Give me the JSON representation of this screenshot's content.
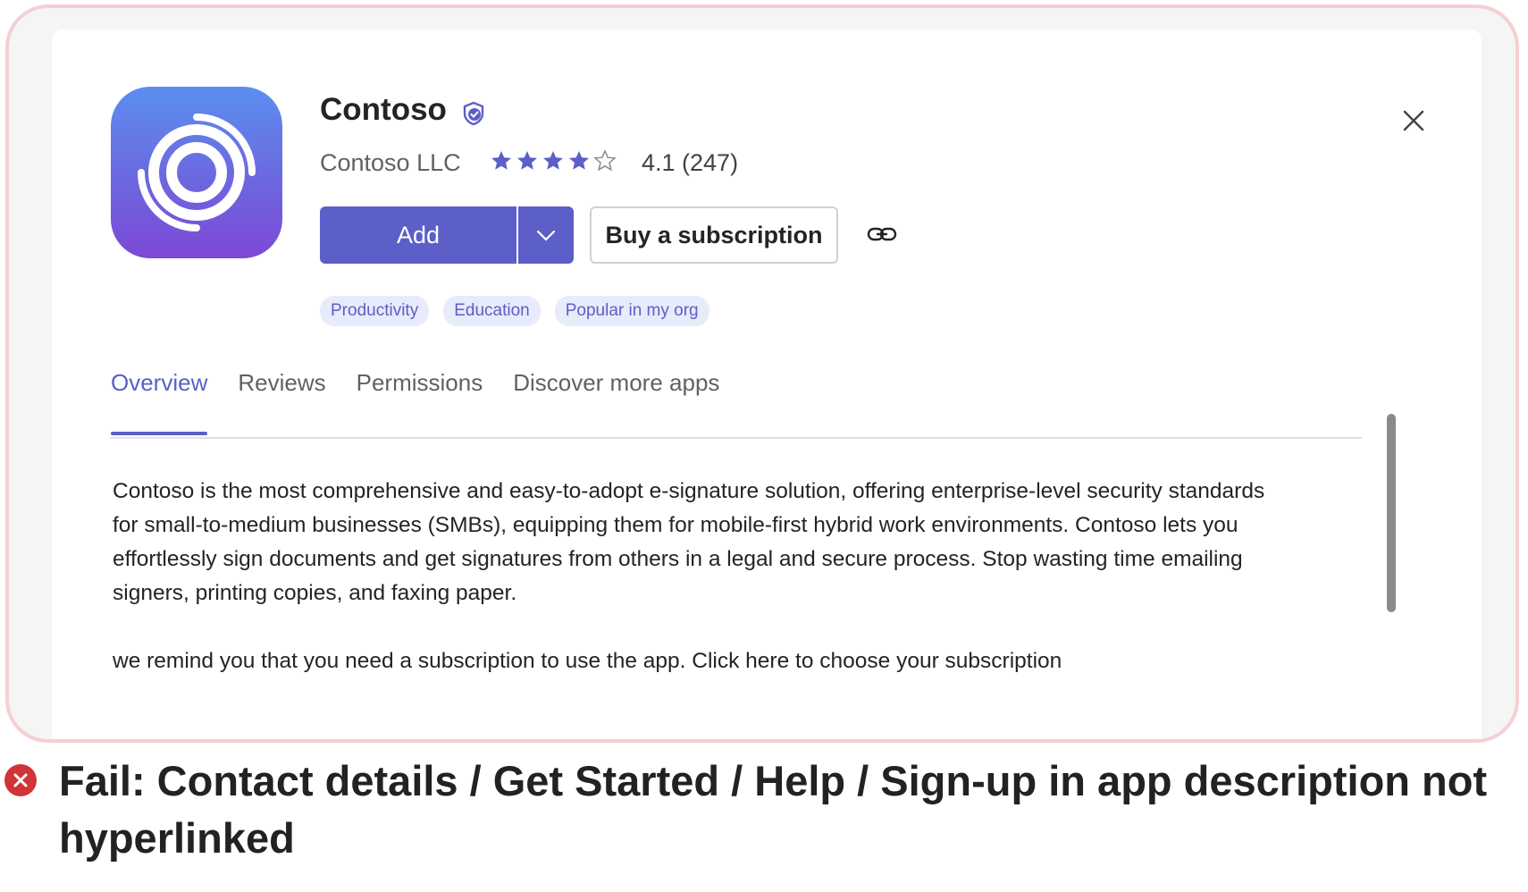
{
  "app": {
    "name": "Contoso",
    "publisher": "Contoso LLC",
    "rating": 4.1,
    "rating_text": "4.1 (247)",
    "stars_filled": 4,
    "stars_total": 5
  },
  "actions": {
    "add_label": "Add",
    "buy_label": "Buy a subscription"
  },
  "tags": [
    "Productivity",
    "Education",
    "Popular in my org"
  ],
  "tabs": [
    "Overview",
    "Reviews",
    "Permissions",
    "Discover more apps"
  ],
  "description": {
    "paragraph1": "Contoso is the most comprehensive and easy-to-adopt e-signature solution, offering enterprise-level security standards for small-to-medium businesses (SMBs), equipping them for mobile-first hybrid work environments. Contoso lets you effortlessly sign documents and get signatures from others in a legal and secure process. Stop wasting time emailing signers, printing copies, and faxing paper.",
    "paragraph2": "we remind you that  you need a subscription to use the app. Click here to choose your subscription"
  },
  "verdict": {
    "text": "Fail: Contact details / Get Started / Help / Sign-up in app description not hyperlinked"
  },
  "colors": {
    "accent": "#5b5fc7",
    "frame_border": "#f6cfd3",
    "fail_red": "#d13438"
  }
}
